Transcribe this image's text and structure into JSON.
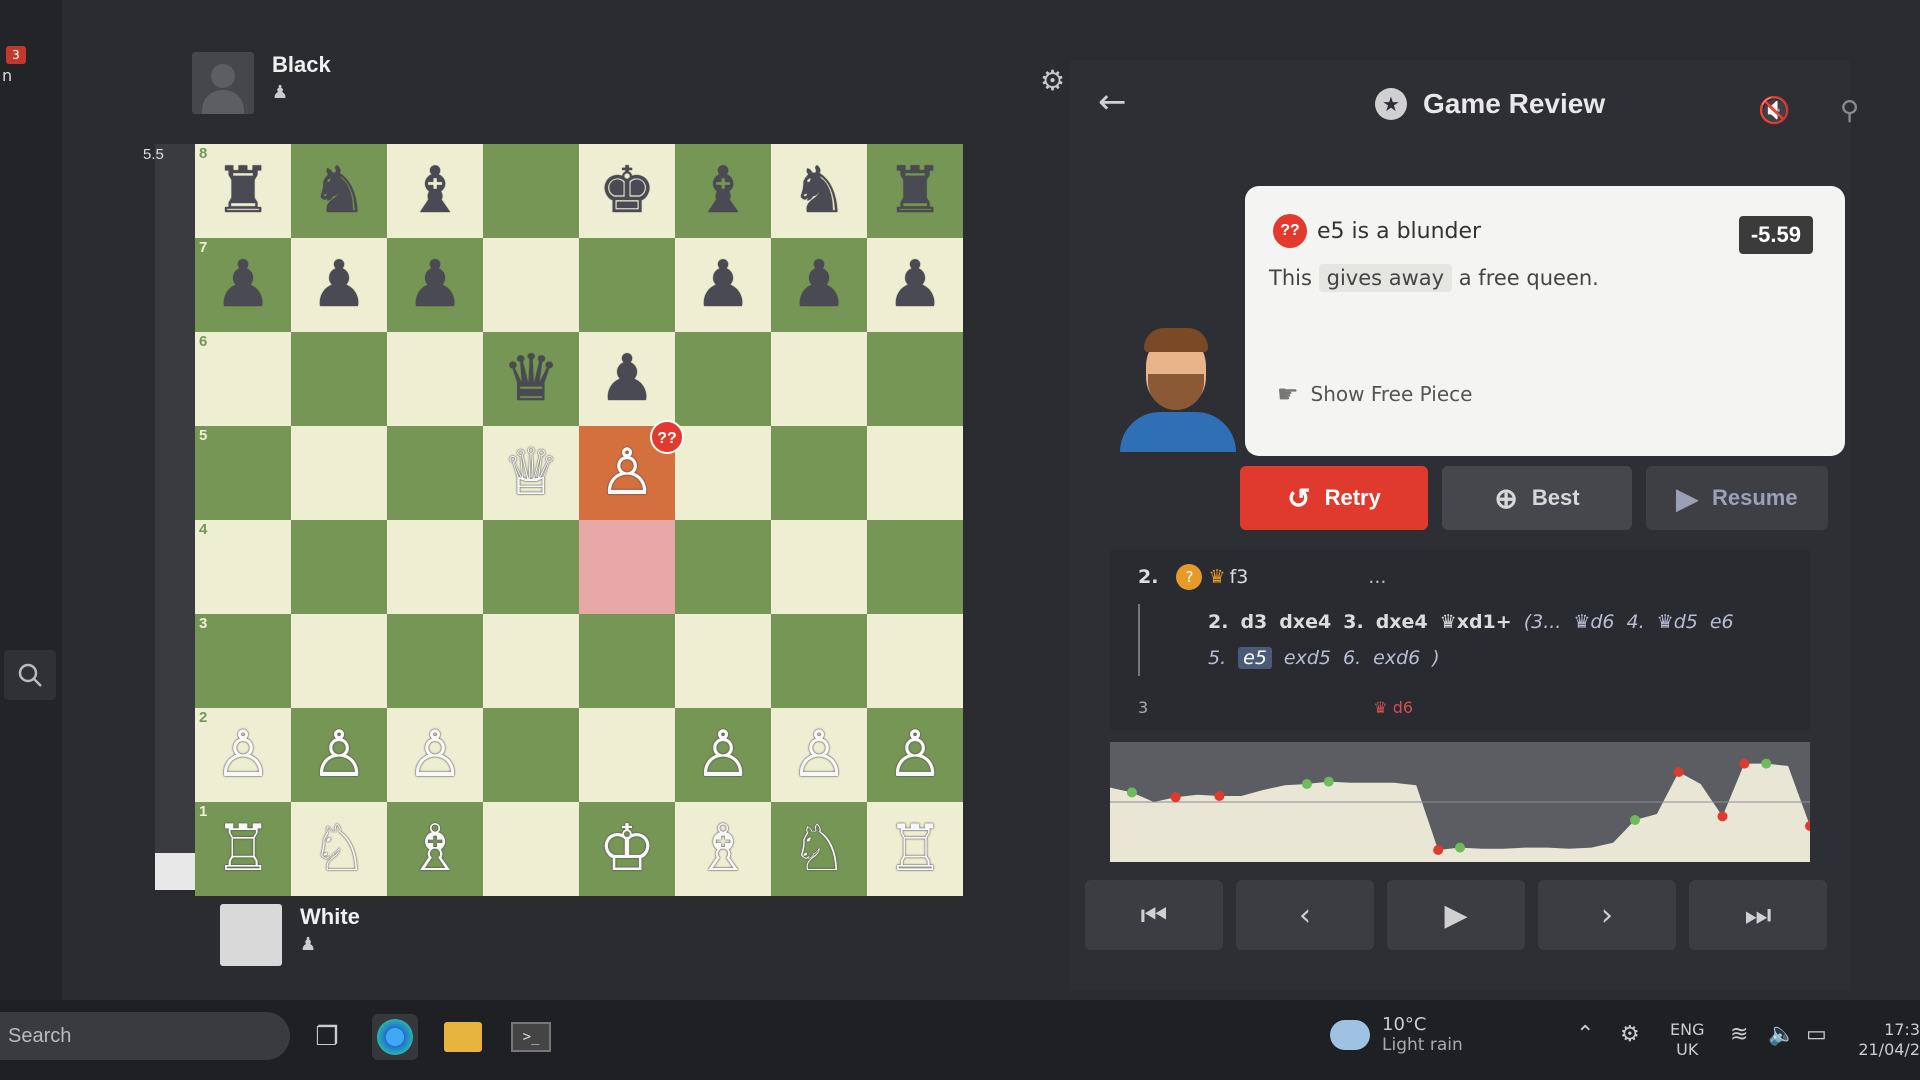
{
  "sidebar": {
    "notif_count": "3",
    "partial_letter": "n",
    "search_icon": "search-icon"
  },
  "players": {
    "black": {
      "name": "Black",
      "flag": "♟"
    },
    "white": {
      "name": "White",
      "flag": "♟"
    }
  },
  "eval_bar": {
    "label": "5.5",
    "white_fraction": 0.05
  },
  "board": {
    "ranks": [
      "8",
      "7",
      "6",
      "5",
      "4",
      "3",
      "2",
      "1"
    ],
    "position": [
      [
        "♜",
        "♞",
        "♝",
        "",
        "♚",
        "♝",
        "♞",
        "♜"
      ],
      [
        "♟",
        "♟",
        "♟",
        "",
        "",
        "♟",
        "♟",
        "♟"
      ],
      [
        "",
        "",
        "",
        "♛",
        "♟",
        "",
        "",
        ""
      ],
      [
        "",
        "",
        "",
        "♕",
        "♙",
        "",
        "",
        ""
      ],
      [
        "",
        "",
        "",
        "",
        "",
        "",
        "",
        ""
      ],
      [
        "",
        "",
        "",
        "",
        "",
        "",
        "",
        ""
      ],
      [
        "♙",
        "♙",
        "♙",
        "",
        "",
        "♙",
        "♙",
        "♙"
      ],
      [
        "♖",
        "♘",
        "♗",
        "",
        "♔",
        "♗",
        "♘",
        "♖"
      ]
    ],
    "piece_colors": [
      [
        "b",
        "b",
        "b",
        "",
        "b",
        "b",
        "b",
        "b"
      ],
      [
        "b",
        "b",
        "b",
        "",
        "",
        "b",
        "b",
        "b"
      ],
      [
        "",
        "",
        "",
        "b",
        "b",
        "",
        "",
        ""
      ],
      [
        "",
        "",
        "",
        "w",
        "w",
        "",
        "",
        ""
      ],
      [
        "",
        "",
        "",
        "",
        "",
        "",
        "",
        ""
      ],
      [
        "",
        "",
        "",
        "",
        "",
        "",
        "",
        ""
      ],
      [
        "w",
        "w",
        "w",
        "",
        "",
        "w",
        "w",
        "w"
      ],
      [
        "w",
        "w",
        "w",
        "",
        "w",
        "w",
        "w",
        "w"
      ]
    ],
    "highlight_from": "e4",
    "highlight_to": "e5",
    "blunder_mark": "??"
  },
  "review": {
    "title": "Game Review",
    "coach": {
      "headline_icon": "??",
      "headline": "e5 is a blunder",
      "desc_prefix": "This",
      "desc_highlight": "gives away",
      "desc_suffix": "a free queen.",
      "eval": "-5.59",
      "show_free_label": "Show Free Piece"
    },
    "buttons": {
      "retry": "Retry",
      "best": "Best",
      "resume": "Resume"
    },
    "moves": {
      "row1_num": "2.",
      "row1_icon": "?",
      "row1_piece": "♛",
      "row1_move": "f3",
      "row1_dots": "...",
      "variation_line1": [
        {
          "t": "2.",
          "s": "main"
        },
        {
          "t": "d3",
          "s": "main"
        },
        {
          "t": "dxe4",
          "s": "main"
        },
        {
          "t": "3.",
          "s": "main"
        },
        {
          "t": "dxe4",
          "s": "main"
        },
        {
          "t": "♛xd1+",
          "s": "main"
        },
        {
          "t": "(3...",
          "s": "side"
        },
        {
          "t": "♛d6",
          "s": "side"
        },
        {
          "t": "4.",
          "s": "side"
        },
        {
          "t": "♛d5",
          "s": "side"
        },
        {
          "t": "e6",
          "s": "side"
        }
      ],
      "variation_line2": [
        {
          "t": "5.",
          "s": "side"
        },
        {
          "t": "e5",
          "s": "sel"
        },
        {
          "t": "exd5",
          "s": "side"
        },
        {
          "t": "6.",
          "s": "side"
        },
        {
          "t": "exd6",
          "s": "side"
        },
        {
          "t": ")",
          "s": "side"
        }
      ],
      "row3_num": "3",
      "row3_text": "♛ d6"
    },
    "graph": {
      "points": [
        0.62,
        0.58,
        0.5,
        0.54,
        0.56,
        0.55,
        0.55,
        0.6,
        0.64,
        0.65,
        0.67,
        0.66,
        0.66,
        0.66,
        0.64,
        0.1,
        0.12,
        0.11,
        0.11,
        0.12,
        0.12,
        0.11,
        0.12,
        0.16,
        0.35,
        0.4,
        0.75,
        0.65,
        0.38,
        0.82,
        0.82,
        0.8,
        0.3
      ],
      "white_color": "#e9e6d6",
      "black_color": "#5b5d63",
      "dot_good": "#6dbb5a",
      "dot_bad": "#e03a2e"
    }
  },
  "navigation": {
    "first": "⏮",
    "prev": "‹",
    "play": "▶",
    "next": "›",
    "last": "⏭"
  },
  "taskbar": {
    "search_placeholder": "Search",
    "weather_temp": "10°C",
    "weather_cond": "Light rain",
    "lang_top": "ENG",
    "lang_bottom": "UK",
    "time": "17:3",
    "date": "21/04/2"
  },
  "colors": {
    "board_light": "#eeeed2",
    "board_dark": "#769656",
    "accent_red": "#e03a2e"
  }
}
